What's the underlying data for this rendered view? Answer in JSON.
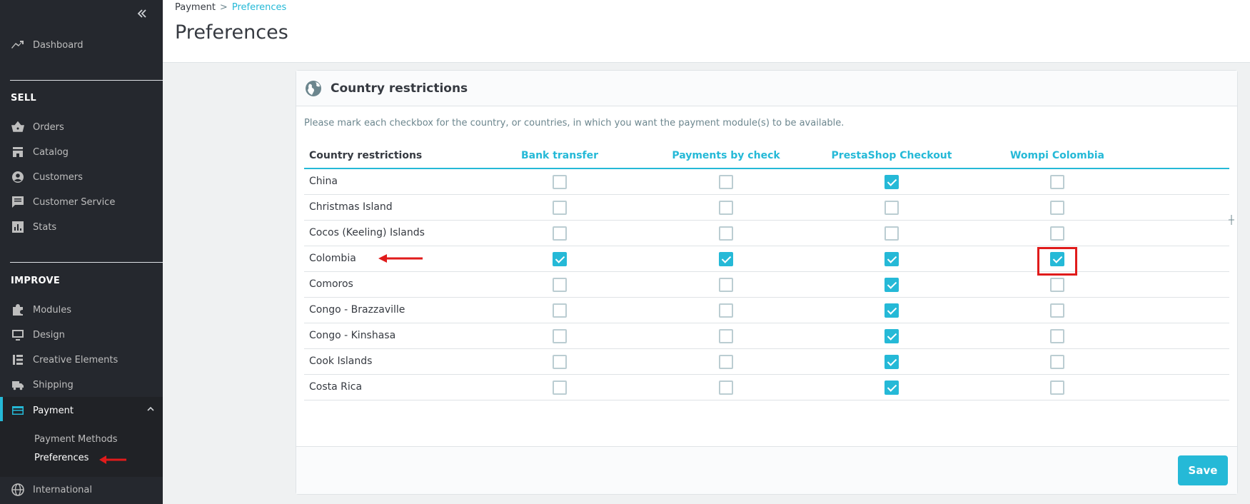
{
  "sidebar": {
    "dashboard": "Dashboard",
    "section_sell": "SELL",
    "sell_items": [
      "Orders",
      "Catalog",
      "Customers",
      "Customer Service",
      "Stats"
    ],
    "section_improve": "IMPROVE",
    "improve_items": [
      "Modules",
      "Design",
      "Creative Elements",
      "Shipping"
    ],
    "payment": "Payment",
    "payment_sub": [
      "Payment Methods",
      "Preferences"
    ],
    "international": "International"
  },
  "breadcrumb": {
    "parent": "Payment",
    "separator": ">",
    "current": "Preferences"
  },
  "page_title": "Preferences",
  "card": {
    "title": "Country restrictions",
    "description": "Please mark each checkbox for the country, or countries, in which you want the payment module(s) to be available.",
    "table": {
      "first_column": "Country restrictions",
      "modules": [
        "Bank transfer",
        "Payments by check",
        "PrestaShop Checkout",
        "Wompi Colombia"
      ],
      "rows": [
        {
          "country": "China",
          "checks": [
            false,
            false,
            true,
            false
          ]
        },
        {
          "country": "Christmas Island",
          "checks": [
            false,
            false,
            false,
            false
          ]
        },
        {
          "country": "Cocos (Keeling) Islands",
          "checks": [
            false,
            false,
            false,
            false
          ]
        },
        {
          "country": "Colombia",
          "checks": [
            true,
            true,
            true,
            true
          ]
        },
        {
          "country": "Comoros",
          "checks": [
            false,
            false,
            true,
            false
          ]
        },
        {
          "country": "Congo - Brazzaville",
          "checks": [
            false,
            false,
            true,
            false
          ]
        },
        {
          "country": "Congo - Kinshasa",
          "checks": [
            false,
            false,
            true,
            false
          ]
        },
        {
          "country": "Cook Islands",
          "checks": [
            false,
            false,
            true,
            false
          ]
        },
        {
          "country": "Costa Rica",
          "checks": [
            false,
            false,
            true,
            false
          ]
        }
      ]
    },
    "save_label": "Save"
  },
  "colors": {
    "accent": "#25b9d7",
    "sidebar_bg": "#25282e",
    "annotation_red": "#e01b1b"
  },
  "icons": [
    "collapse-icon",
    "dashboard-icon",
    "orders-icon",
    "catalog-icon",
    "customers-icon",
    "customer-service-icon",
    "stats-icon",
    "modules-icon",
    "design-icon",
    "creative-elements-icon",
    "shipping-icon",
    "payment-icon",
    "chevron-up-icon",
    "international-icon",
    "globe-icon"
  ]
}
